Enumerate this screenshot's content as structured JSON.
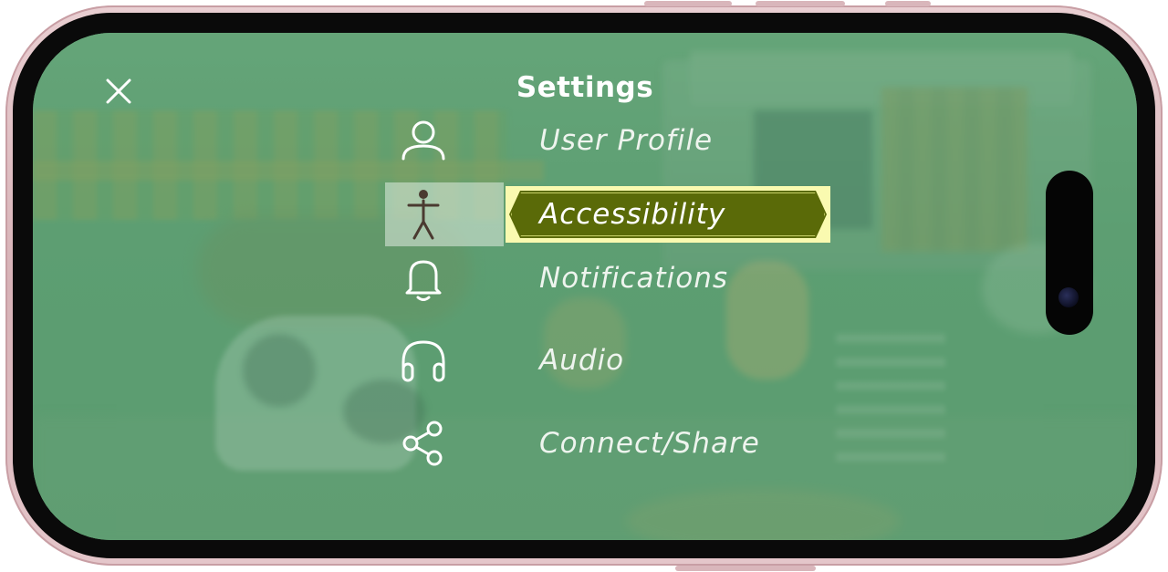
{
  "screen": {
    "title": "Settings",
    "close_icon": "close-icon",
    "selected_index": 1
  },
  "menu": {
    "items": [
      {
        "label": "User Profile",
        "icon": "user-icon"
      },
      {
        "label": "Accessibility",
        "icon": "accessibility-icon"
      },
      {
        "label": "Notifications",
        "icon": "bell-icon"
      },
      {
        "label": "Audio",
        "icon": "headphones-icon"
      },
      {
        "label": "Connect/Share",
        "icon": "share-icon"
      }
    ]
  },
  "colors": {
    "accent_selected_bg": "#5a6a08",
    "accent_selected_border": "#fafab0",
    "text": "#ffffff",
    "overlay": "#5ca078",
    "device_frame": "#e9cfd2"
  }
}
